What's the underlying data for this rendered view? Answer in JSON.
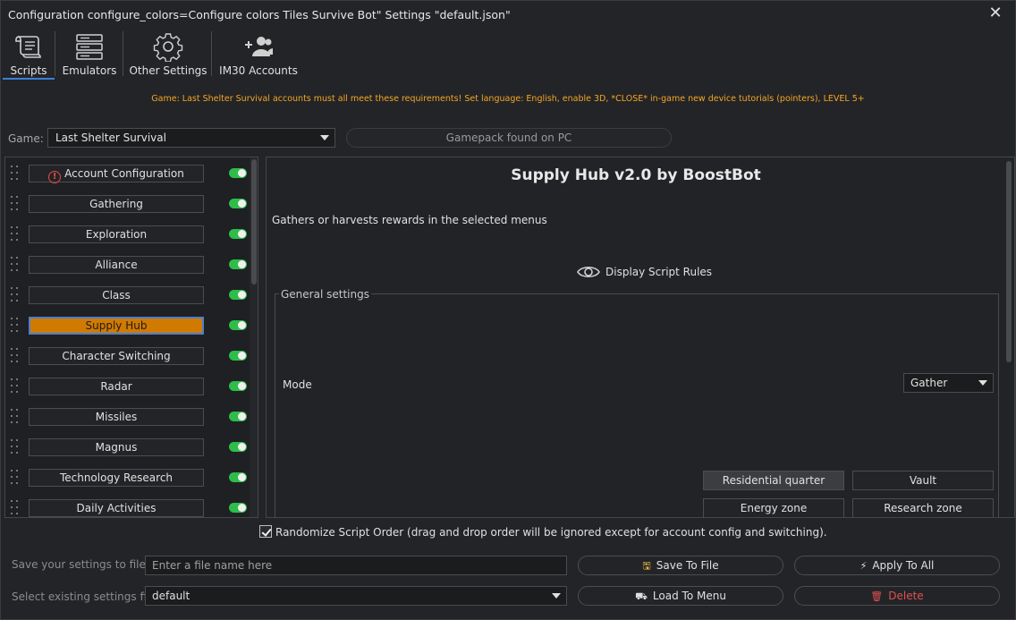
{
  "window": {
    "title": "Configuration configure_colors=Configure colors Tiles Survive Bot\" Settings \"default.json\"",
    "close_glyph": "✕"
  },
  "tabs": [
    {
      "label": "Scripts",
      "icon": "scroll-icon",
      "active": true
    },
    {
      "label": "Emulators",
      "icon": "server-icon",
      "active": false
    },
    {
      "label": "Other Settings",
      "icon": "gear-icon",
      "active": false
    },
    {
      "label": "IM30 Accounts",
      "icon": "users-add-icon",
      "active": false
    }
  ],
  "notice": "Game: Last Shelter Survival accounts must all meet these requirements! Set language: English, enable 3D, *CLOSE* in-game new device tutorials (pointers), LEVEL 5+",
  "game": {
    "label": "Game:",
    "selected": "Last Shelter Survival",
    "gamepack_status": "Gamepack found on PC"
  },
  "scripts": [
    {
      "label": "Account Configuration",
      "warning": true,
      "enabled": true,
      "active": false
    },
    {
      "label": "Gathering",
      "enabled": true,
      "active": false
    },
    {
      "label": "Exploration",
      "enabled": true,
      "active": false
    },
    {
      "label": "Alliance",
      "enabled": true,
      "active": false
    },
    {
      "label": "Class",
      "enabled": true,
      "active": false
    },
    {
      "label": "Supply Hub",
      "enabled": true,
      "active": true
    },
    {
      "label": "Character Switching",
      "enabled": true,
      "active": false
    },
    {
      "label": "Radar",
      "enabled": true,
      "active": false
    },
    {
      "label": "Missiles",
      "enabled": true,
      "active": false
    },
    {
      "label": "Magnus",
      "enabled": true,
      "active": false
    },
    {
      "label": "Technology Research",
      "enabled": true,
      "active": false
    },
    {
      "label": "Daily Activities",
      "enabled": true,
      "active": false
    }
  ],
  "detail": {
    "title": "Supply Hub v2.0 by BoostBot",
    "description": "Gathers or harvests rewards in the selected menus",
    "rules_label": "Display Script Rules",
    "general_legend": "General settings",
    "mode_label": "Mode",
    "mode_value": "Gather",
    "zones": [
      {
        "label": "Residential quarter",
        "selected": true
      },
      {
        "label": "Vault",
        "selected": false
      },
      {
        "label": "Energy zone",
        "selected": false
      },
      {
        "label": "Research zone",
        "selected": false
      }
    ]
  },
  "randomize": {
    "checked": true,
    "label": "Randomize Script Order (drag and drop order will be ignored except for account config and switching)."
  },
  "footer": {
    "save_label": "Save your settings to file",
    "file_placeholder": "Enter a file name here",
    "select_label": "Select existing settings file",
    "selected_file": "default",
    "save_btn": "Save To File",
    "apply_btn": "Apply To All",
    "load_btn": "Load To Menu",
    "delete_btn": "Delete"
  },
  "colors": {
    "accent": "#3c7fd6",
    "active_script": "#d17a00",
    "toggle_on": "#2ebd4a",
    "notice": "#f5a623",
    "danger": "#e05050"
  }
}
